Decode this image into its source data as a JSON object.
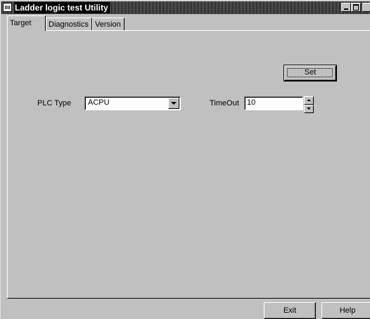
{
  "window": {
    "title": "Ladder logic test Utility"
  },
  "tabs": [
    {
      "label": "Target",
      "active": true
    },
    {
      "label": "Diagnostics",
      "active": false
    },
    {
      "label": "Version",
      "active": false
    }
  ],
  "target_panel": {
    "set_button_label": "Set",
    "plc_type_label": "PLC Type",
    "plc_type_value": "ACPU",
    "timeout_label": "TimeOut",
    "timeout_value": "10"
  },
  "footer": {
    "exit_label": "Exit",
    "help_label": "Help"
  }
}
